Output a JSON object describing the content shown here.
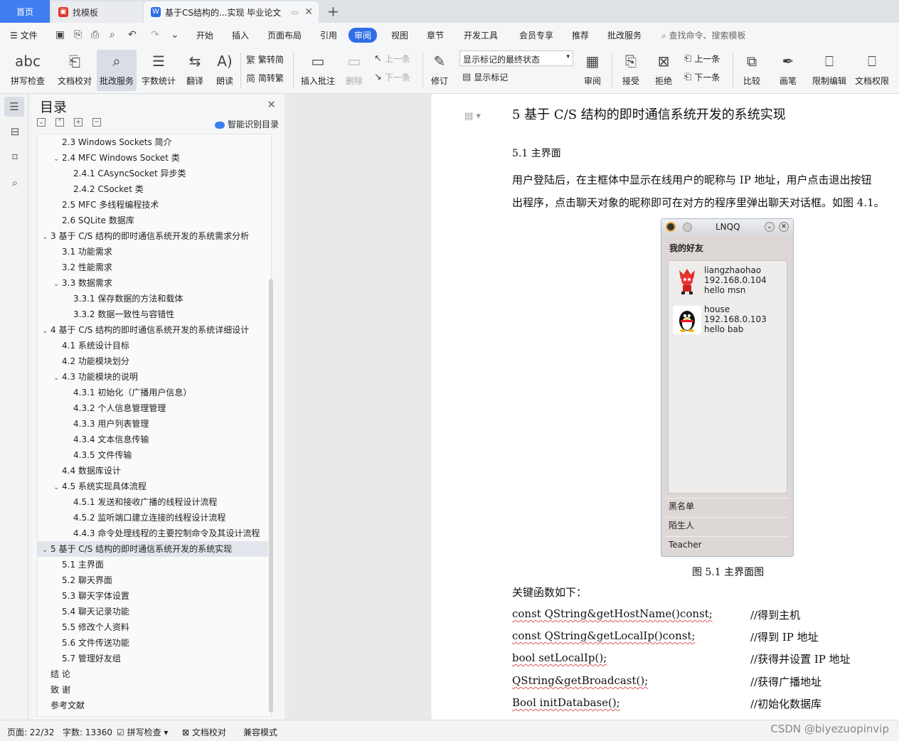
{
  "tabs": {
    "home": "首页",
    "template": "找模板",
    "doc": "基于CS结构的...实现 毕业论文"
  },
  "menu": {
    "file": "文件",
    "items": [
      "开始",
      "插入",
      "页面布局",
      "引用",
      "审阅",
      "视图",
      "章节",
      "开发工具",
      "会员专享",
      "推荐",
      "批改服务"
    ],
    "active": "审阅",
    "search": "查找命令、搜索模板"
  },
  "ribbon": {
    "spell": "拼写检查",
    "proof": "文档校对",
    "correct": "批改服务",
    "count": "字数统计",
    "translate": "翻译",
    "read": "朗读",
    "trad": "繁转简",
    "simp": "简转繁",
    "insert_comment": "插入批注",
    "delete": "删除",
    "prev_c": "上一条",
    "next_c": "下一条",
    "revise": "修订",
    "markup_select": "显示标记的最终状态",
    "show_markup": "显示标记",
    "review": "审阅",
    "accept": "接受",
    "reject": "拒绝",
    "prev": "上一条",
    "next": "下一条",
    "compare": "比较",
    "pen": "画笔",
    "restrict": "限制编辑",
    "rights": "文档权限"
  },
  "toc": {
    "title": "目录",
    "smart": "智能识别目录",
    "items": [
      {
        "t": "2.3    Windows Sockets 简介",
        "l": 2,
        "c": ""
      },
      {
        "t": "2.4    MFC Windows Socket 类",
        "l": 2,
        "c": "v"
      },
      {
        "t": "2.4.1    CAsyncSocket 异步类",
        "l": 3,
        "c": ""
      },
      {
        "t": "2.4.2    CSocket 类",
        "l": 3,
        "c": ""
      },
      {
        "t": "2.5    MFC 多线程编程技术",
        "l": 2,
        "c": ""
      },
      {
        "t": "2.6    SQLite 数据库",
        "l": 2,
        "c": ""
      },
      {
        "t": "3  基于 C/S 结构的即时通信系统开发的系统需求分析",
        "l": 1,
        "c": "v"
      },
      {
        "t": "3.1  功能需求",
        "l": 2,
        "c": ""
      },
      {
        "t": "3.2  性能需求",
        "l": 2,
        "c": ""
      },
      {
        "t": "3.3  数据需求",
        "l": 2,
        "c": "v"
      },
      {
        "t": "3.3.1  保存数据的方法和载体",
        "l": 3,
        "c": ""
      },
      {
        "t": "3.3.2  数据一致性与容错性",
        "l": 3,
        "c": ""
      },
      {
        "t": "4  基于 C/S 结构的即时通信系统开发的系统详细设计",
        "l": 1,
        "c": "v"
      },
      {
        "t": "4.1  系统设计目标",
        "l": 2,
        "c": ""
      },
      {
        "t": "4.2  功能模块划分",
        "l": 2,
        "c": ""
      },
      {
        "t": "4.3  功能模块的说明",
        "l": 2,
        "c": "v"
      },
      {
        "t": "4.3.1  初始化（广播用户信息）",
        "l": 3,
        "c": ""
      },
      {
        "t": "4.3.2  个人信息管理管理",
        "l": 3,
        "c": ""
      },
      {
        "t": "4.3.3  用户列表管理",
        "l": 3,
        "c": ""
      },
      {
        "t": "4.3.4  文本信息传输",
        "l": 3,
        "c": ""
      },
      {
        "t": "4.3.5  文件传输",
        "l": 3,
        "c": ""
      },
      {
        "t": "4.4  数据库设计",
        "l": 2,
        "c": ""
      },
      {
        "t": "4.5  系统实现具体流程",
        "l": 2,
        "c": "v"
      },
      {
        "t": "4.5.1  发送和接收广播的线程设计流程",
        "l": 3,
        "c": ""
      },
      {
        "t": "4.5.2  监听端口建立连接的线程设计流程",
        "l": 3,
        "c": ""
      },
      {
        "t": "4.4.3  命令处理线程的主要控制命令及其设计流程",
        "l": 3,
        "c": ""
      },
      {
        "t": "5  基于 C/S 结构的即时通信系统开发的系统实现",
        "l": 1,
        "c": "v",
        "sel": true
      },
      {
        "t": "5.1  主界面",
        "l": 2,
        "c": ""
      },
      {
        "t": "5.2  聊天界面",
        "l": 2,
        "c": ""
      },
      {
        "t": "5.3  聊天字体设置",
        "l": 2,
        "c": ""
      },
      {
        "t": "5.4  聊天记录功能",
        "l": 2,
        "c": ""
      },
      {
        "t": "5.5  修改个人资料",
        "l": 2,
        "c": ""
      },
      {
        "t": "5.6  文件传送功能",
        "l": 2,
        "c": ""
      },
      {
        "t": "5.7  管理好友组",
        "l": 2,
        "c": ""
      },
      {
        "t": "结  论",
        "l": 1,
        "c": ""
      },
      {
        "t": "致  谢",
        "l": 1,
        "c": ""
      },
      {
        "t": "参考文献",
        "l": 1,
        "c": ""
      }
    ]
  },
  "doc": {
    "h1": "5  基于 C/S 结构的即时通信系统开发的系统实现",
    "h2": "5.1  主界面",
    "p1": "    用户登陆后，在主框体中显示在线用户的昵称与 IP 地址，用户点击退出按钮",
    "p2": "出程序，点击聊天对象的昵称即可在对方的程序里弹出聊天对话框。如图 4.1。",
    "figure": {
      "title": "LNQQ",
      "heading": "我的好友",
      "friends": [
        {
          "name": "liangzhaohao",
          "ip": "192.168.0.104",
          "msg": "hello msn"
        },
        {
          "name": "house",
          "ip": "192.168.0.103",
          "msg": "hello bab"
        }
      ],
      "groups": [
        "黑名单",
        "陌生人",
        "Teacher"
      ]
    },
    "caption": "图 5.1  主界面图",
    "key": "关键函数如下：",
    "code": [
      {
        "f": "const QString&getHostName()const;",
        "c": "//得到主机"
      },
      {
        "f": "const QString&getLocalIp()const;",
        "c": "//得到 IP 地址"
      },
      {
        "f": "bool setLocalIp();",
        "c": "//获得并设置 IP 地址"
      },
      {
        "f": "QString&getBroadcast();",
        "c": "//获得广播地址"
      },
      {
        "f": "Bool initDatabase();",
        "c": "//初始化数据库"
      }
    ]
  },
  "status": {
    "page": "页面: 22/32",
    "words": "字数: 13360",
    "spell": "拼写检查",
    "proof": "文档校对",
    "compat": "兼容模式",
    "watermark": "CSDN @biyezuopinvip"
  }
}
